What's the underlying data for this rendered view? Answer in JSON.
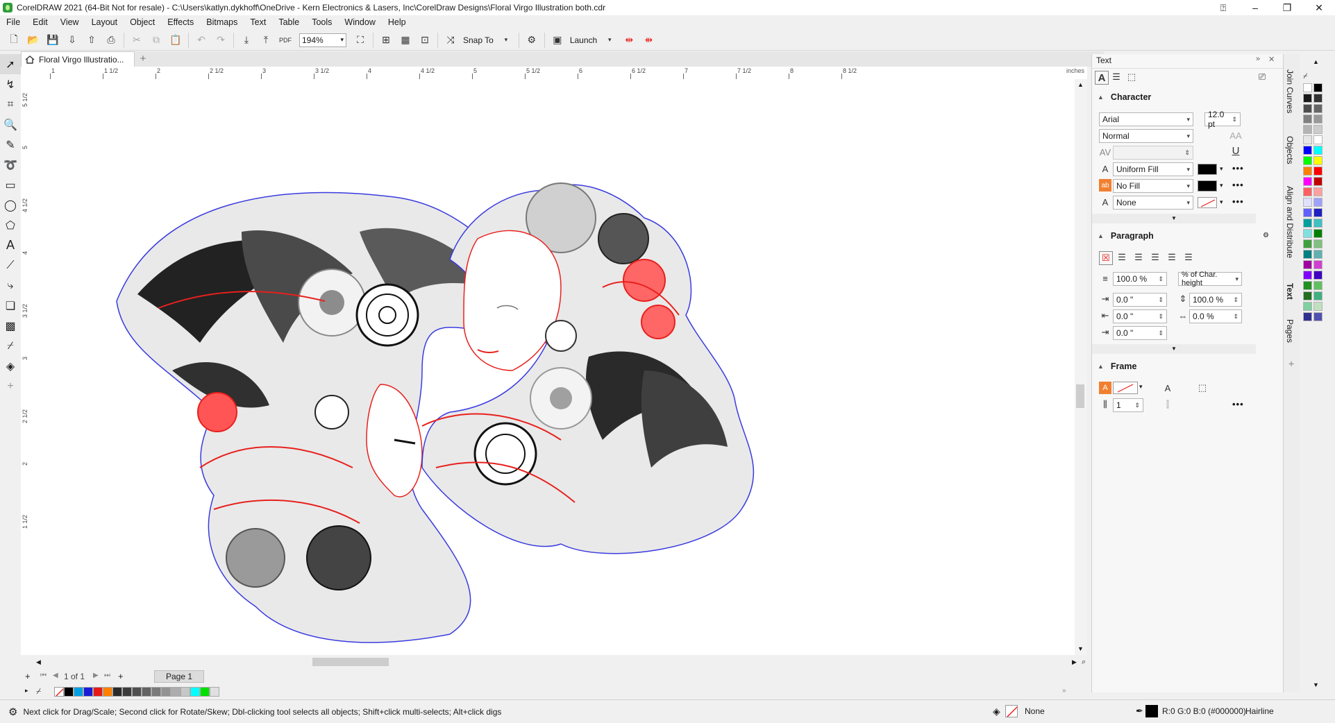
{
  "window": {
    "title": "CorelDRAW 2021 (64-Bit Not for resale) - C:\\Users\\katlyn.dykhoff\\OneDrive - Kern Electronics & Lasers, Inc\\CorelDraw Designs\\Floral Virgo Illustration both.cdr"
  },
  "menu": [
    "File",
    "Edit",
    "View",
    "Layout",
    "Object",
    "Effects",
    "Bitmaps",
    "Text",
    "Table",
    "Tools",
    "Window",
    "Help"
  ],
  "toolbar": {
    "zoom": "194%",
    "snap_label": "Snap To",
    "launch_label": "Launch"
  },
  "document": {
    "tab_name": "Floral Virgo Illustratio...",
    "ruler_units": "inches",
    "page_counter": "1 of 1",
    "page_tab": "Page 1"
  },
  "hruler_labels": [
    "1",
    "1 1/2",
    "2",
    "2 1/2",
    "3",
    "3 1/2",
    "4",
    "4 1/2",
    "5",
    "5 1/2",
    "6",
    "6 1/2",
    "7",
    "7 1/2",
    "8",
    "8 1/2"
  ],
  "vruler_labels": [
    "5 1/2",
    "5",
    "4 1/2",
    "4",
    "3 1/2",
    "3",
    "2 1/2",
    "2",
    "1 1/2"
  ],
  "docker": {
    "title": "Text",
    "character": {
      "header": "Character",
      "font": "Arial",
      "size": "12.0 pt",
      "style": "Normal",
      "fill_type": "Uniform Fill",
      "bg_fill": "No Fill",
      "outline": "None"
    },
    "paragraph": {
      "header": "Paragraph",
      "line_spacing": "100.0 %",
      "spacing_unit": "% of Char. height",
      "indent_first": "0.0 \"",
      "indent_left": "0.0 \"",
      "indent_right": "0.0 \"",
      "char_spacing": "100.0 %",
      "word_spacing": "0.0 %"
    },
    "frame": {
      "header": "Frame",
      "columns": "1"
    }
  },
  "vertical_tabs": [
    "Join Curves",
    "Objects",
    "Align and Distribute",
    "Text",
    "Pages"
  ],
  "status": {
    "hint": "Next click for Drag/Scale; Second click for Rotate/Skew; Dbl-clicking tool selects all objects; Shift+click multi-selects; Alt+click digs",
    "fill_label": "None",
    "outline_color": "R:0 G:0 B:0 (#000000)",
    "outline_width": "Hairline"
  },
  "colors": {
    "accent_red": "#e8201c",
    "outline_blue": "#3a3ae0",
    "selected_tab": "#ffffff"
  },
  "bottom_palette": [
    "#ffffff",
    "#000000",
    "#00a0e3",
    "#1b1bd6",
    "#e41b17",
    "#ff8000",
    "#2b2b2b",
    "#3c3c3c",
    "#4f4f4f",
    "#636363",
    "#7a7a7a",
    "#939393",
    "#adadad",
    "#c7c7c7",
    "#00ffff",
    "#00e000",
    "#e0e0e0"
  ],
  "right_palette": [
    "#ffffff",
    "#000000",
    "#1a1a1a",
    "#333333",
    "#4d4d4d",
    "#666666",
    "#808080",
    "#999999",
    "#b3b3b3",
    "#cccccc",
    "#e6e6e6",
    "#ffffff",
    "#0000ff",
    "#00ffff",
    "#00ff00",
    "#ffff00",
    "#ff8000",
    "#ff0000",
    "#ff00ff",
    "#c00000",
    "#ff6060",
    "#ffa0a0",
    "#e0e0ff",
    "#a0a0ff",
    "#6060ff",
    "#2020c0",
    "#00a0a0",
    "#40c0c0",
    "#80e0e0",
    "#008000",
    "#40a040",
    "#80c080",
    "#008080",
    "#60b0b0",
    "#a000a0",
    "#d040d0",
    "#8000ff",
    "#4000c0",
    "#209020",
    "#60c060",
    "#207020",
    "#40b080",
    "#80d0a0",
    "#c0e0c0",
    "#303090",
    "#5050b0"
  ]
}
